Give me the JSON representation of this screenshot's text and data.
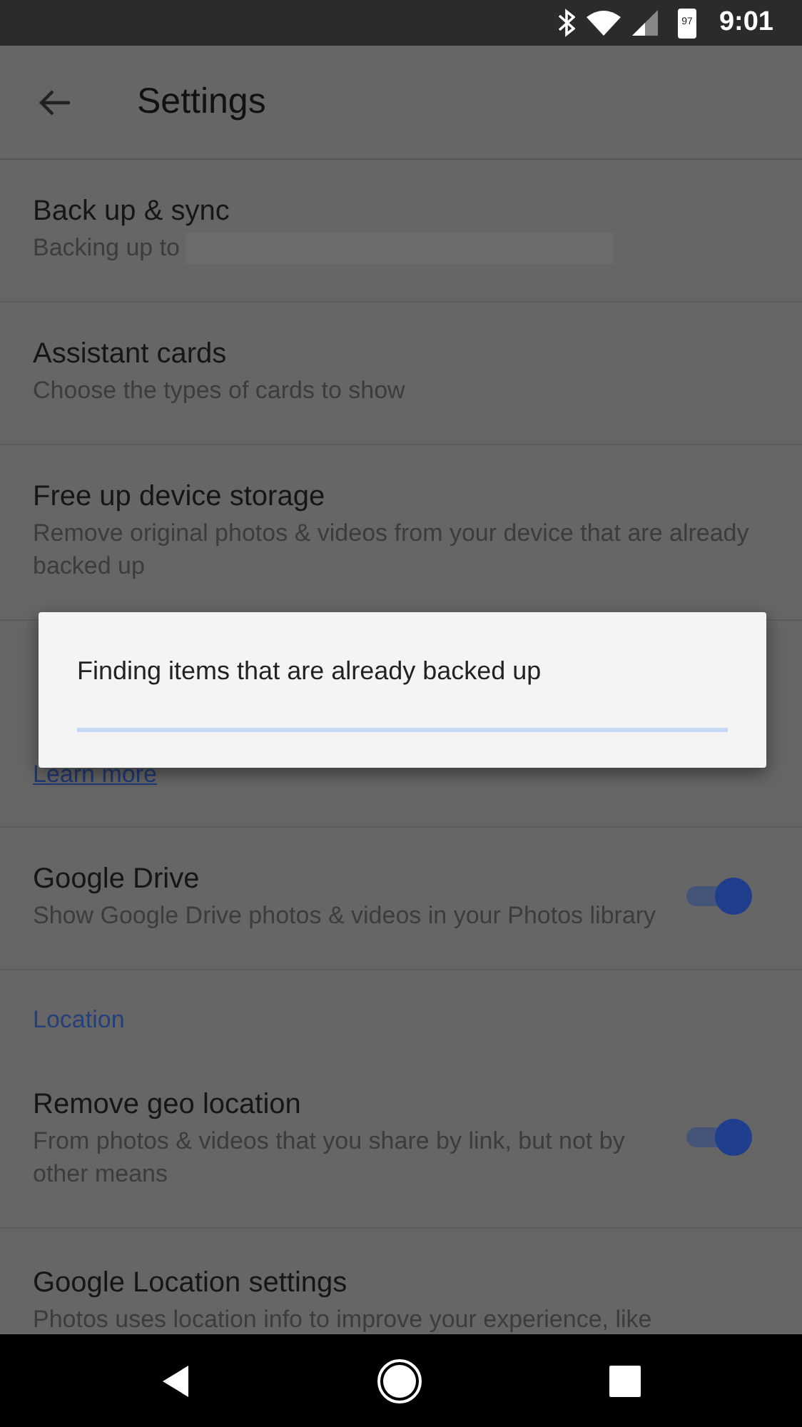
{
  "status_bar": {
    "time": "9:01",
    "battery": "97"
  },
  "app_bar": {
    "title": "Settings"
  },
  "items": [
    {
      "kind": "setting",
      "title": "Back up & sync",
      "subtitle": "Backing up to",
      "redacted": true
    },
    {
      "kind": "setting",
      "title": "Assistant cards",
      "subtitle": "Choose the types of cards to show"
    },
    {
      "kind": "setting",
      "title": "Free up device storage",
      "subtitle": "Remove original photos & videos from your device that are already backed up"
    },
    {
      "kind": "covered",
      "link": "Learn more"
    },
    {
      "kind": "toggle",
      "title": "Google Drive",
      "subtitle": "Show Google Drive photos & videos in your Photos library",
      "on": true
    },
    {
      "kind": "header",
      "title": "Location"
    },
    {
      "kind": "toggle",
      "title": "Remove geo location",
      "subtitle": "From photos & videos that you share by link, but not by other means",
      "on": true
    },
    {
      "kind": "setting",
      "title": "Google Location settings",
      "subtitle": "Photos uses location info to improve your experience, like",
      "clipped": true
    }
  ],
  "dialog": {
    "message": "Finding items that are already backed up",
    "level": 0
  }
}
